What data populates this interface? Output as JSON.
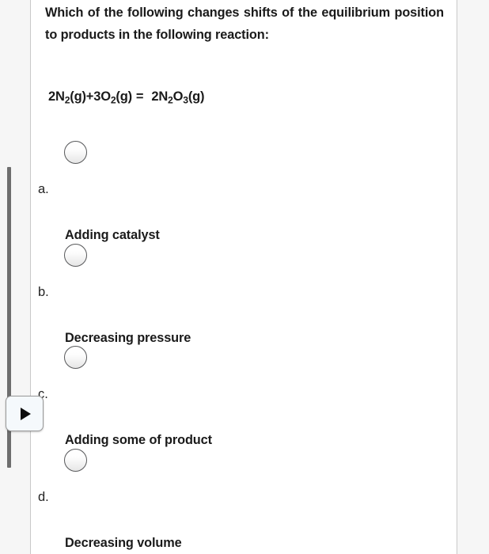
{
  "question": {
    "text": "Which of the following changes shifts of the equilibrium position to products in the following reaction:"
  },
  "equation": {
    "full": "2N2(g)+3O2(g) =  2N2O3(g)",
    "reactant1_coeff": "2",
    "reactant1_formula": "N",
    "reactant1_sub": "2",
    "reactant1_state": "(g)",
    "plus": "+",
    "reactant2_coeff": "3",
    "reactant2_formula": "O",
    "reactant2_sub": "2",
    "reactant2_state": "(g)",
    "equals": "=",
    "product_coeff": "2",
    "product_el1": "N",
    "product_sub1": "2",
    "product_el2": "O",
    "product_sub2": "3",
    "product_state": "(g)"
  },
  "choices": [
    {
      "letter": "a.",
      "label": "Adding catalyst",
      "selected": false
    },
    {
      "letter": "b.",
      "label": "Decreasing pressure",
      "selected": false
    },
    {
      "letter": "c.",
      "label": "Adding some of product",
      "selected": false
    },
    {
      "letter": "d.",
      "label": "Decreasing volume",
      "selected": false
    }
  ],
  "controls": {
    "play_button_icon": "play-triangle-icon",
    "scrollbar_orientation": "vertical"
  },
  "colors": {
    "page_background": "#f6f6f6",
    "sheet_background": "#ffffff",
    "sheet_border": "#c9c9c9",
    "text": "#1a1a1a",
    "radio_border": "#58595b",
    "scroll_thumb": "#6e6e6e",
    "button_face": "#f5f9fc",
    "button_border": "#9a9a9a",
    "triangle": "#0d0d0d"
  }
}
